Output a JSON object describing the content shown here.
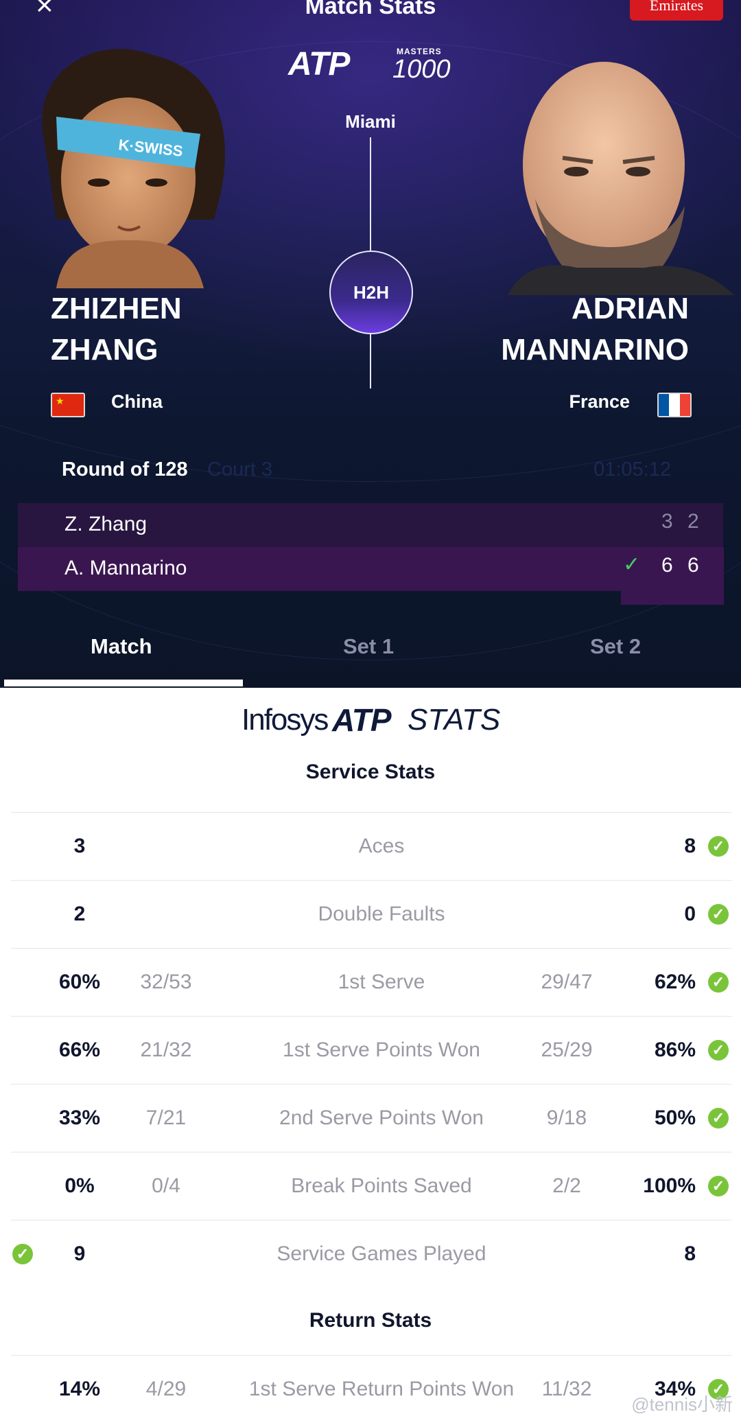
{
  "header": {
    "close_icon": "×",
    "title": "Match Stats",
    "sponsor": "Emirates",
    "logo_atp": "ATP",
    "logo_masters": "MASTERS",
    "logo_1000": "1000",
    "city": "Miami",
    "h2h_label": "H2H"
  },
  "players": {
    "p1": {
      "first": "ZHIZHEN",
      "last": "ZHANG",
      "country": "China",
      "short": "Z. Zhang",
      "sets": [
        "3",
        "2"
      ]
    },
    "p2": {
      "first": "ADRIAN",
      "last": "MANNARINO",
      "country": "France",
      "short": "A. Mannarino",
      "sets": [
        "6",
        "6"
      ],
      "winner_mark": "✓"
    }
  },
  "match_info": {
    "round": "Round of 128",
    "court": "Court 3",
    "duration": "01:05:12"
  },
  "tabs": [
    {
      "label": "Match",
      "active": true
    },
    {
      "label": "Set 1",
      "active": false
    },
    {
      "label": "Set 2",
      "active": false
    }
  ],
  "stats_brand": {
    "infosys": "Infosys",
    "atp": "ATP",
    "stats": "STATS"
  },
  "service_stats": {
    "title": "Service Stats",
    "rows": [
      {
        "label": "Aces",
        "left": "3",
        "left_frac": "",
        "right": "8",
        "right_frac": "",
        "leader": "right"
      },
      {
        "label": "Double Faults",
        "left": "2",
        "left_frac": "",
        "right": "0",
        "right_frac": "",
        "leader": "right"
      },
      {
        "label": "1st Serve",
        "left": "60%",
        "left_frac": "32/53",
        "right": "62%",
        "right_frac": "29/47",
        "leader": "right"
      },
      {
        "label": "1st Serve Points Won",
        "left": "66%",
        "left_frac": "21/32",
        "right": "86%",
        "right_frac": "25/29",
        "leader": "right"
      },
      {
        "label": "2nd Serve Points Won",
        "left": "33%",
        "left_frac": "7/21",
        "right": "50%",
        "right_frac": "9/18",
        "leader": "right"
      },
      {
        "label": "Break Points Saved",
        "left": "0%",
        "left_frac": "0/4",
        "right": "100%",
        "right_frac": "2/2",
        "leader": "right"
      },
      {
        "label": "Service Games Played",
        "left": "9",
        "left_frac": "",
        "right": "8",
        "right_frac": "",
        "leader": "left"
      }
    ]
  },
  "return_stats": {
    "title": "Return Stats",
    "rows": [
      {
        "label": "1st Serve Return Points Won",
        "left": "14%",
        "left_frac": "4/29",
        "right": "34%",
        "right_frac": "11/32",
        "leader": "right"
      }
    ]
  },
  "watermark": "@tennis小新",
  "colors": {
    "accent_green": "#7ac43a",
    "check_green": "#3ed06a",
    "hero_bg": "#0c1528",
    "winner_row": "#3a1650"
  }
}
